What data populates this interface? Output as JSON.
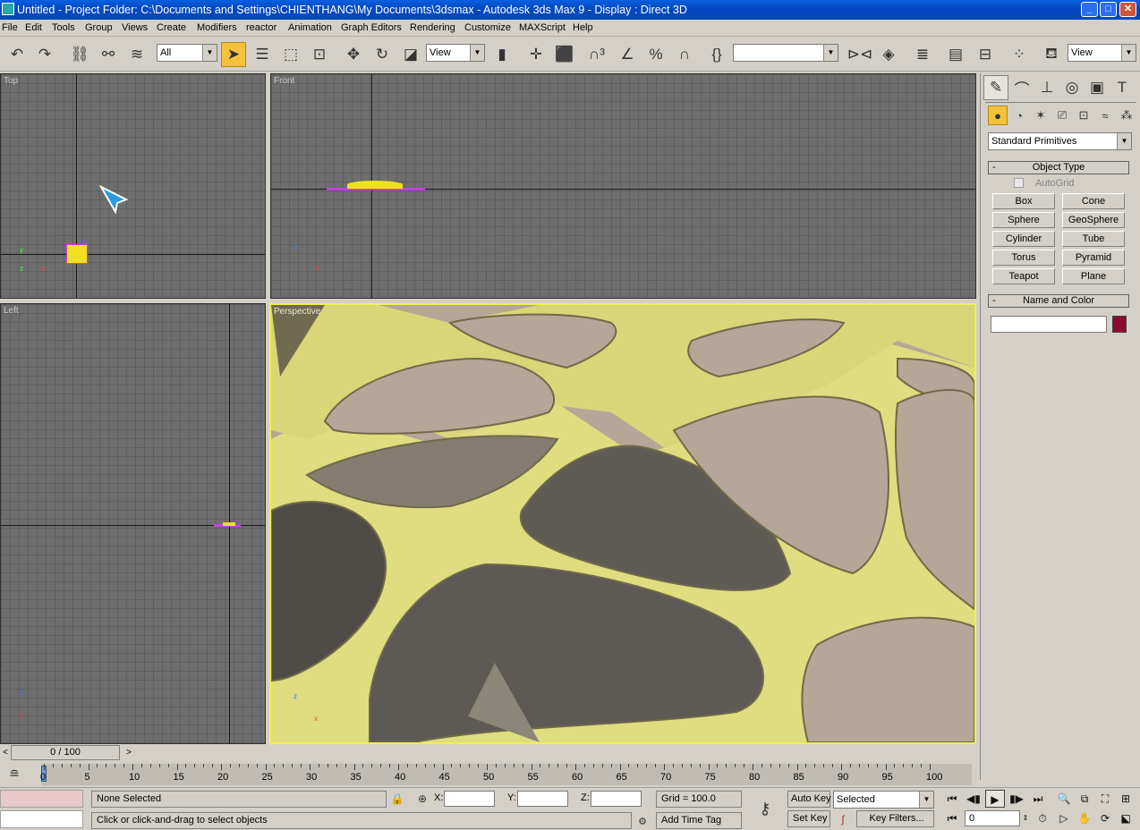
{
  "window": {
    "title": "Untitled      - Project Folder: C:\\Documents and Settings\\CHIENTHANG\\My Documents\\3dsmax      - Autodesk 3ds Max 9      - Display : Direct 3D",
    "buttons": {
      "minimize": "_",
      "maximize": "□",
      "close": "✕"
    }
  },
  "menu": [
    "File",
    "Edit",
    "Tools",
    "Group",
    "Views",
    "Create",
    "Modifiers",
    "reactor",
    "Animation",
    "Graph Editors",
    "Rendering",
    "Customize",
    "MAXScript",
    "Help"
  ],
  "toolbar": {
    "selection_filter": "All",
    "ref_coord": "View",
    "named_selection": "",
    "render_type": "View"
  },
  "viewports": {
    "top": "Top",
    "front": "Front",
    "left": "Left",
    "perspective": "Perspective",
    "axis_x": "x",
    "axis_y": "y",
    "axis_z": "z"
  },
  "command_panel": {
    "category_dropdown": "Standard Primitives",
    "object_type": {
      "header": "Object Type",
      "collapse": "-",
      "autogrid": "AutoGrid",
      "buttons": [
        "Box",
        "Cone",
        "Sphere",
        "GeoSphere",
        "Cylinder",
        "Tube",
        "Torus",
        "Pyramid",
        "Teapot",
        "Plane"
      ]
    },
    "name_color": {
      "header": "Name and Color",
      "collapse": "-",
      "name_value": "",
      "color": "#8b0a2f"
    }
  },
  "timeline": {
    "slider_label": "0 / 100",
    "prev": "<",
    "next": ">",
    "ticks": [
      "0",
      "5",
      "10",
      "15",
      "20",
      "25",
      "30",
      "35",
      "40",
      "45",
      "50",
      "55",
      "60",
      "65",
      "70",
      "75",
      "80",
      "85",
      "90",
      "95",
      "100"
    ]
  },
  "status": {
    "selection": "None Selected",
    "prompt": "Click or click-and-drag to select objects",
    "x_label": "X:",
    "y_label": "Y:",
    "z_label": "Z:",
    "x_value": "",
    "y_value": "",
    "z_value": "",
    "grid": "Grid = 100.0",
    "add_time_tag": "Add Time Tag",
    "auto_key": "Auto Key",
    "set_key": "Set Key",
    "key_mode": "Selected",
    "key_filters": "Key Filters...",
    "frame": "0"
  },
  "colors": {
    "viewport_grid": "#6e6e6e",
    "active_border": "#f0f050",
    "selection_highlight": "#f3c23a",
    "titlebar": "#0a5fe0"
  }
}
